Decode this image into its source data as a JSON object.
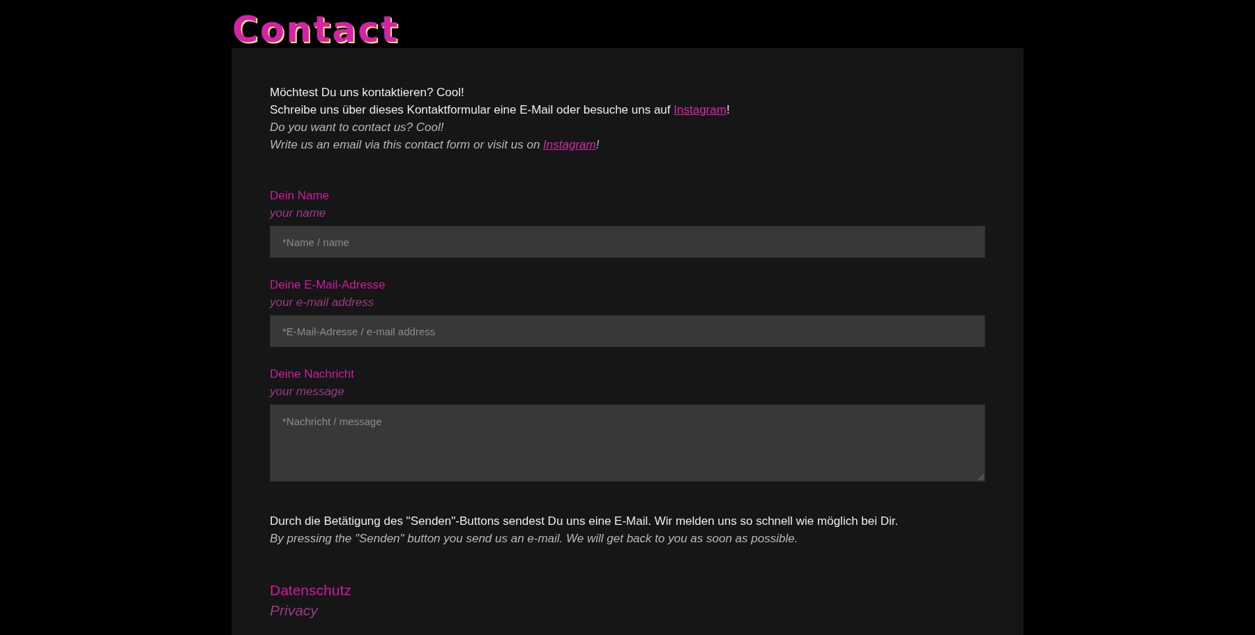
{
  "title": "Contact",
  "intro": [
    {
      "italic": false,
      "parts": [
        {
          "kind": "text",
          "text": "Möchtest Du uns kontaktieren? Cool!"
        }
      ]
    },
    {
      "italic": false,
      "parts": [
        {
          "kind": "text",
          "text": "Schreibe uns über dieses Kontaktformular eine E-Mail oder besuche uns auf "
        },
        {
          "kind": "link",
          "text": "Instagram"
        },
        {
          "kind": "text",
          "text": "!"
        }
      ]
    },
    {
      "italic": true,
      "parts": [
        {
          "kind": "text",
          "text": "Do you want to contact us? Cool!"
        }
      ]
    },
    {
      "italic": true,
      "parts": [
        {
          "kind": "text",
          "text": "Write us an email via this contact form or visit us on "
        },
        {
          "kind": "link",
          "text": "Instagram"
        },
        {
          "kind": "text",
          "text": "!"
        }
      ]
    }
  ],
  "fields": [
    {
      "kind": "input",
      "label": "Dein Name",
      "label_en": "your name",
      "placeholder": "*Name / name"
    },
    {
      "kind": "input",
      "label": "Deine E-Mail-Adresse",
      "label_en": "your e-mail address",
      "placeholder": "*E-Mail-Adresse / e-mail address"
    },
    {
      "kind": "textarea",
      "label": "Deine Nachricht",
      "label_en": "your message",
      "placeholder": "*Nachricht / message"
    }
  ],
  "notice": {
    "de": "Durch die Betätigung des \"Senden\"-Buttons sendest Du uns eine E-Mail. Wir melden uns so schnell wie möglich bei Dir.",
    "en": "By pressing the \"Senden\" button you send us an e-mail. We will get back to you as soon as possible."
  },
  "privacy": {
    "heading": "Datenschutz",
    "heading_en": "Privacy"
  }
}
